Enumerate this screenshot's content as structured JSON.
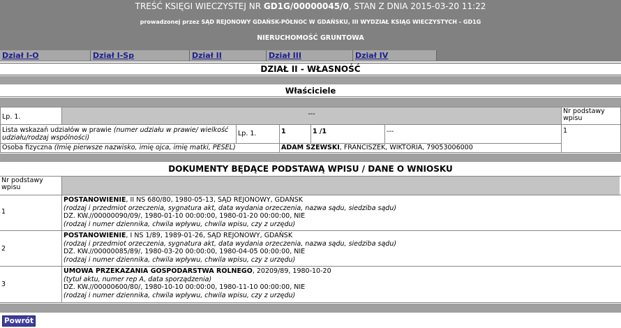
{
  "header": {
    "line1_prefix": "TREŚĆ KSIĘGI WIECZYSTEJ NR",
    "kw_number": "GD1G/00000045/0",
    "line1_suffix": ", STAN Z DNIA 2015-03-20 11:22",
    "court": "prowadzonej przez SĄD REJONOWY GDAŃSK-PÓŁNOC W GDAŃSKU, III WYDZIAŁ KSIĄG WIECZYSTYCH - GD1G",
    "property_type": "NIERUCHOMOŚĆ GRUNTOWA"
  },
  "tabs": [
    "Dział I-O",
    "Dział I-Sp",
    "Dział II",
    "Dział III",
    "Dział IV"
  ],
  "section_title": "DZIAŁ II - WŁASNOŚĆ",
  "owners": {
    "title": "Właściciele",
    "lp_label": "Lp. 1.",
    "lp_value": "---",
    "basis_header": "Nr podstawy wpisu",
    "basis_value": "1",
    "share_label": "Lista wskazań udziałów w prawie",
    "share_label_italic": "(numer udziału w prawie/ wielkość udziału/rodzaj wspólności)",
    "share_lp": "Lp. 1.",
    "share_no": "1",
    "share_size": "1 /1",
    "share_type": "---",
    "person_label": "Osoba fizyczna",
    "person_label_italic": "(Imię pierwsze nazwisko, imię ojca, imię matki, PESEL)",
    "person_name": "ADAM SZEWSKI",
    "person_rest": ", FRANCISZEK, WIKTORIA, 79053006000"
  },
  "documents": {
    "title": "DOKUMENTY BĘDĄCE PODSTAWĄ WPISU / DANE O WNIOSKU",
    "col_header": "Nr podstawy wpisu",
    "rows": [
      {
        "num": "1",
        "type": "POSTANOWIENIE",
        "type_rest": ", II NS 680/80, 1980-05-13, SĄD REJONOWY, GDAŃSK",
        "desc": "(rodzaj i przedmiot orzeczenia, sygnatura akt, data wydania orzeczenia, nazwa sądu, siedziba sądu)",
        "journal": "DZ. KW.//00000090/09/, 1980-01-10 00:00:00, 1980-01-20 00:00:00, NIE",
        "journal_desc": "(rodzaj i numer dziennika, chwila wpływu, chwila wpisu, czy z urzędu)"
      },
      {
        "num": "2",
        "type": "POSTANOWIENIE",
        "type_rest": ", I NS 1/89, 1989-01-26, SĄD REJONOWY, GDAŃSK",
        "desc": "(rodzaj i przedmiot orzeczenia, sygnatura akt, data wydania orzeczenia, nazwa sądu, siedziba sądu)",
        "journal": "DZ. KW.//00000085/89/, 1980-03-20 00:00:00, 1980-04-05 00:00:00, NIE",
        "journal_desc": "(rodzaj i numer dziennika, chwila wpływu, chwila wpisu, czy z urzędu)"
      },
      {
        "num": "3",
        "type": "UMOWA PRZEKAZANIA GOSPODARSTWA ROLNEGO",
        "type_rest": ", 20209/89, 1980-10-20",
        "desc": "(tytuł aktu, numer rep A, data sporządzenia)",
        "journal": "DZ. KW.//00000600/80/, 1980-10-10 00:00:00, 1980-11-10 00:00:00, NIE",
        "journal_desc": "(rodzaj i numer dziennika, chwila wpływu, chwila wpisu, czy z urzędu)"
      }
    ]
  },
  "back_button": "Powrót",
  "colors": {
    "header_bg": "#818181",
    "tab_bg": "#a8a8a8",
    "link": "#1f1f8f",
    "button_bg": "#3d3d9e"
  }
}
